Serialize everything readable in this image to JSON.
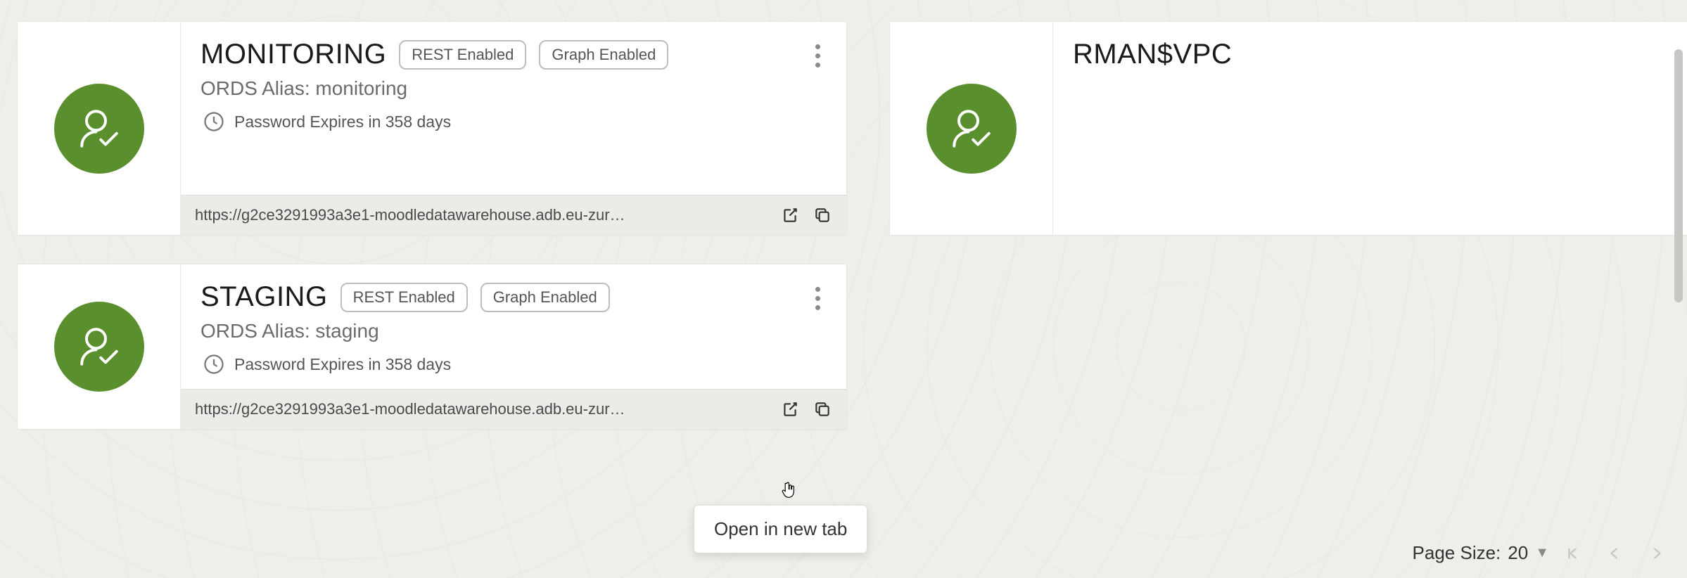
{
  "cards": [
    {
      "title": "MONITORING",
      "tags": [
        "REST Enabled",
        "Graph Enabled"
      ],
      "alias_label": "ORDS Alias: monitoring",
      "expiry": "Password Expires in 358 days",
      "url": "https://g2ce3291993a3e1-moodledatawarehouse.adb.eu-zur…",
      "has_footer": true
    },
    {
      "title": "RMAN$VPC",
      "tags": [],
      "alias_label": "",
      "expiry": "",
      "url": "",
      "has_footer": false
    },
    {
      "title": "STAGING",
      "tags": [
        "REST Enabled",
        "Graph Enabled"
      ],
      "alias_label": "ORDS Alias: staging",
      "expiry": "Password Expires in 358 days",
      "url": "https://g2ce3291993a3e1-moodledatawarehouse.adb.eu-zur…",
      "has_footer": true
    }
  ],
  "tooltip": "Open in new tab",
  "pager": {
    "label_prefix": "Page Size:",
    "size": "20"
  }
}
